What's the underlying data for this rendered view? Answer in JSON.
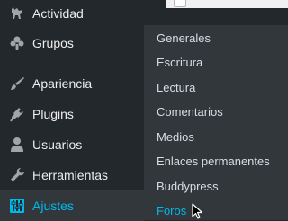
{
  "sidebar": {
    "items": [
      {
        "label": "Actividad",
        "icon": "activity-icon"
      },
      {
        "label": "Grupos",
        "icon": "groups-icon"
      },
      {
        "label": "Apariencia",
        "icon": "paintbrush-icon"
      },
      {
        "label": "Plugins",
        "icon": "plugin-icon"
      },
      {
        "label": "Usuarios",
        "icon": "users-icon"
      },
      {
        "label": "Herramientas",
        "icon": "wrench-icon"
      },
      {
        "label": "Ajustes",
        "icon": "settings-icon"
      }
    ],
    "active_item": "Ajustes"
  },
  "submenu": {
    "items": [
      {
        "label": "Generales"
      },
      {
        "label": "Escritura"
      },
      {
        "label": "Lectura"
      },
      {
        "label": "Comentarios"
      },
      {
        "label": "Medios"
      },
      {
        "label": "Enlaces permanentes"
      },
      {
        "label": "Buddypress"
      },
      {
        "label": "Foros"
      }
    ],
    "active_item": "Foros"
  },
  "colors": {
    "sidebar_bg": "#23282d",
    "submenu_bg": "#32373c",
    "text": "#eeeeee",
    "active_text": "#00b9eb"
  }
}
